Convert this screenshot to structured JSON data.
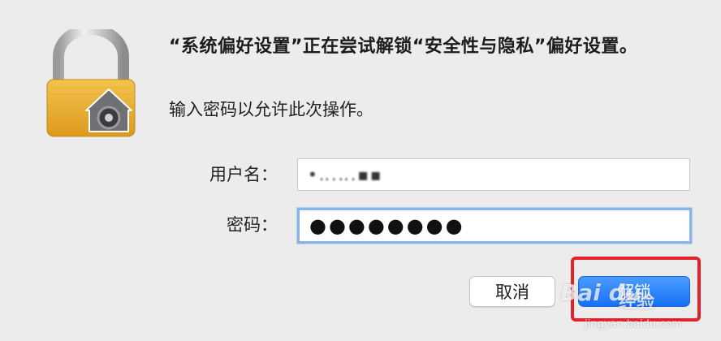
{
  "dialog": {
    "title": "“系统偏好设置”正在尝试解锁“安全性与隐私”偏好设置。",
    "subtitle": "输入密码以允许此次操作。",
    "icon": "padlock-icon",
    "username_label": "用户名：",
    "username_value": "•‥.‥.▪▪",
    "password_label": "密码：",
    "password_value": "●●●●●●●●",
    "cancel_label": "取消",
    "unlock_label": "解锁",
    "accent_color": "#1a73f0",
    "highlight_color": "#e4202a"
  },
  "watermark": {
    "logo": "Bai du",
    "text": "经验",
    "url": "jingyan.baidu.com"
  }
}
